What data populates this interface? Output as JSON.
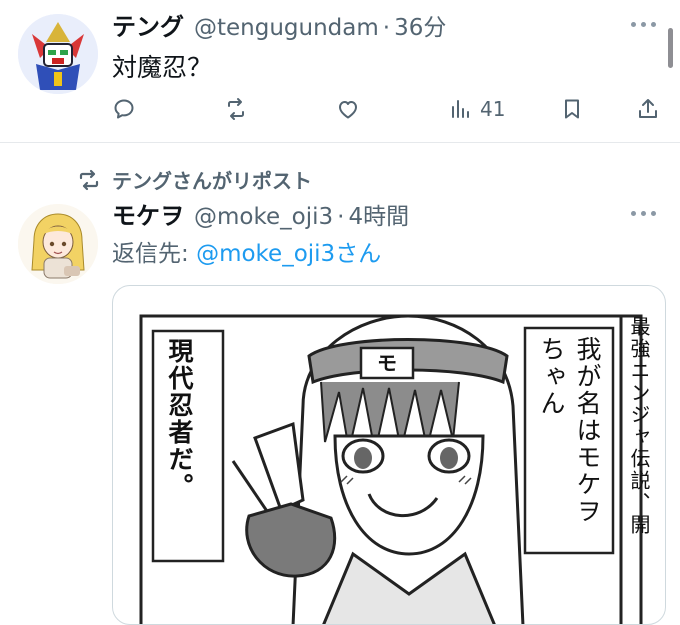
{
  "tweets": [
    {
      "name": "テング",
      "handle": "@tengugundam",
      "separator": "·",
      "time": "36分",
      "text": "対魔忍？",
      "avatar_icon": "robot-avatar-icon",
      "actions": {
        "reply_icon": "reply-icon",
        "retweet_icon": "retweet-icon",
        "like_icon": "heart-icon",
        "views_icon": "views-icon",
        "views_count": "41",
        "bookmark_icon": "bookmark-icon",
        "share_icon": "share-icon"
      }
    },
    {
      "repost_label": "テングさんがリポスト",
      "name": "モケヲ",
      "handle": "@moke_oji3",
      "separator": "·",
      "time": "4時間",
      "reply_prefix": "返信先:",
      "reply_mention": "@moke_oji3",
      "reply_suffix": "さん",
      "avatar_icon": "blonde-girl-avatar-icon",
      "image": {
        "headband_char": "モ",
        "left_caption": "現代忍者だ。",
        "speech_caption": "我が名はモケヲちゃん",
        "right_caption": "最強ニンジャ伝説、開"
      }
    }
  ],
  "colors": {
    "primary_text": "#0f1419",
    "secondary_text": "#536471",
    "link": "#1d9bf0",
    "divider": "#e6e9ec"
  }
}
